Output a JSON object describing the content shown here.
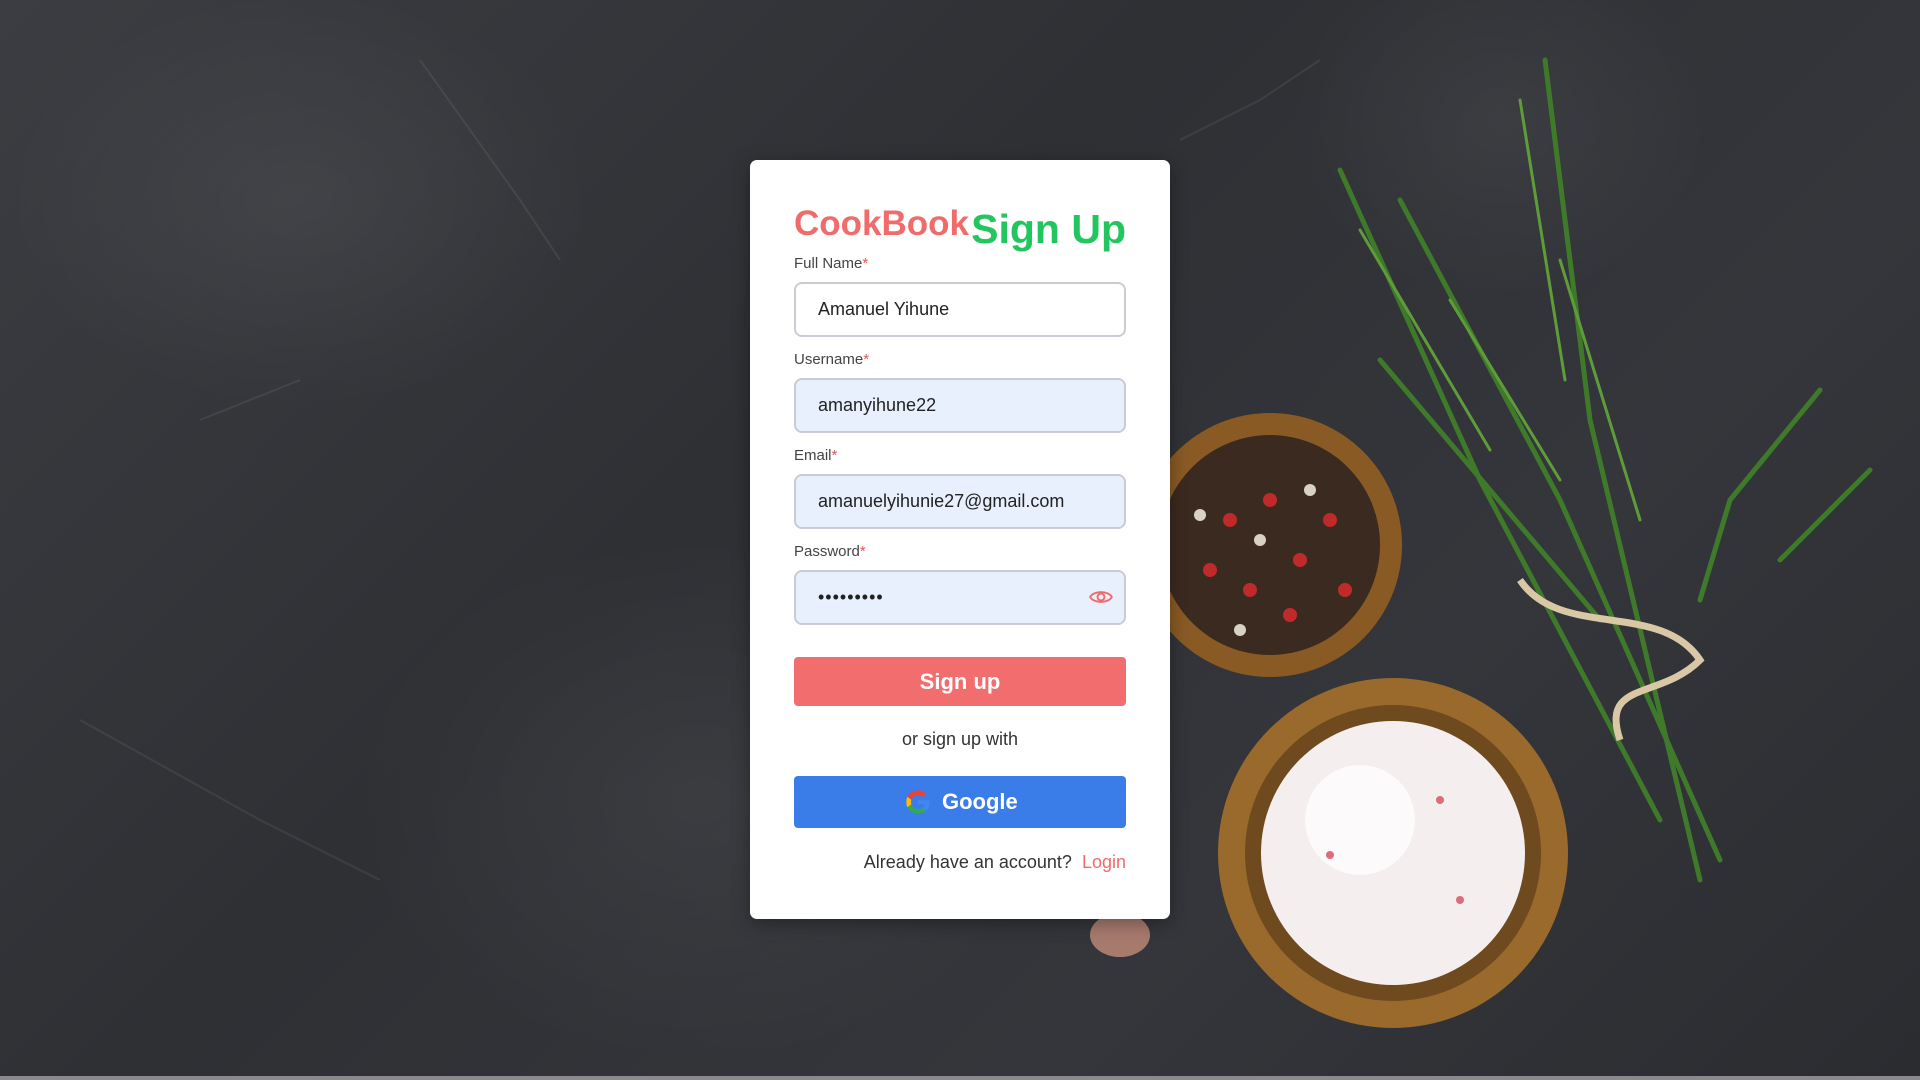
{
  "brand": "CookBook",
  "page_title": "Sign Up",
  "form": {
    "full_name": {
      "label": "Full Name",
      "required_mark": "*",
      "value": "Amanuel Yihune"
    },
    "username": {
      "label": "Username",
      "required_mark": "*",
      "value": "amanyihune22"
    },
    "email": {
      "label": "Email",
      "required_mark": "*",
      "value": "amanuelyihunie27@gmail.com"
    },
    "password": {
      "label": "Password",
      "required_mark": "*",
      "value": "•••••••••",
      "toggle_icon": "eye-icon"
    }
  },
  "signup_button": "Sign up",
  "alt_signup_text": "or sign up with",
  "google_button": "Google",
  "footer": {
    "prompt": "Already have an account?",
    "login_link": "Login"
  },
  "colors": {
    "brand": "#f06b6b",
    "title": "#22c55e",
    "signup_button": "#f26d6d",
    "google_button": "#3b7de8",
    "autofill_bg": "#e8f0fe"
  }
}
